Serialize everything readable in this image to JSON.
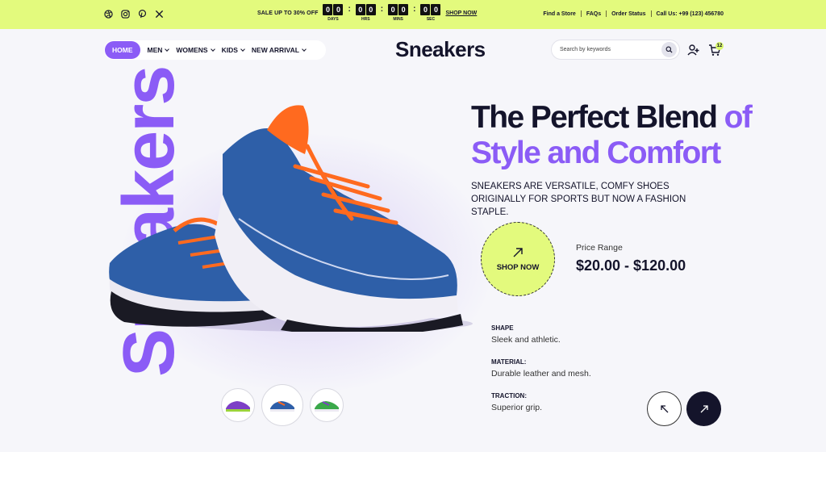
{
  "topbar": {
    "social_icons": [
      "dribbble-icon",
      "instagram-icon",
      "pinterest-icon",
      "x-icon"
    ],
    "promo_text": "SALE UP TO 30% OFF",
    "countdown": [
      {
        "digits": [
          "0",
          "0"
        ],
        "label": "DAYS"
      },
      {
        "digits": [
          "0",
          "0"
        ],
        "label": "HRS"
      },
      {
        "digits": [
          "0",
          "0"
        ],
        "label": "MINS"
      },
      {
        "digits": [
          "0",
          "0"
        ],
        "label": "SEC"
      }
    ],
    "shop_now": "SHOP NOW",
    "links": [
      "Find a Store",
      "FAQs",
      "Order Status",
      "Call Us: +99 (123) 456780"
    ]
  },
  "nav": {
    "items": [
      {
        "label": "HOME",
        "active": true,
        "dropdown": false
      },
      {
        "label": "MEN",
        "active": false,
        "dropdown": true
      },
      {
        "label": "WOMENS",
        "active": false,
        "dropdown": true
      },
      {
        "label": "KIDS",
        "active": false,
        "dropdown": true
      },
      {
        "label": "NEW ARRIVAL",
        "active": false,
        "dropdown": true
      }
    ]
  },
  "logo": "Sneakers",
  "search": {
    "placeholder": "Search by keywords"
  },
  "cart": {
    "count": "12"
  },
  "hero": {
    "vertical_word": "Sneakers",
    "headline": {
      "part1": "The Perfect Blend",
      "part2": "of",
      "part3": "Style and Comfort"
    },
    "subtitle": "SNEAKERS ARE VERSATILE, COMFY SHOES ORIGINALLY FOR SPORTS BUT NOW A FASHION STAPLE.",
    "shop_button": "SHOP NOW",
    "price_label": "Price Range",
    "price_value": "$20.00 - $120.00",
    "specs": [
      {
        "label": "SHAPE",
        "value": "Sleek and athletic."
      },
      {
        "label": "MATERIAL:",
        "value": "Durable leather and mesh."
      },
      {
        "label": "TRACTION:",
        "value": "Superior grip."
      }
    ]
  },
  "colors": {
    "accent_purple": "#8b5cf6",
    "lime": "#e3fa7d",
    "dark": "#14142b",
    "shoe_blue": "#2e5fa8",
    "shoe_orange": "#ff6a1f"
  }
}
